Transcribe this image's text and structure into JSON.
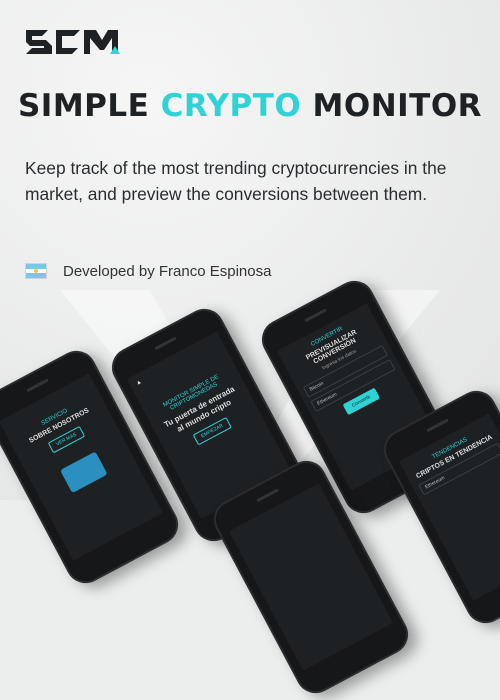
{
  "title": {
    "before": "SIMPLE ",
    "accent": "CRYPTO",
    "after": " MONITOR"
  },
  "description": "Keep track of the most trending cryptocurrencies in the market, and preview the conversions between them.",
  "developer": "Developed by Franco Espinosa",
  "colors": {
    "accent": "#2fd3d6",
    "dark": "#1f2224",
    "background": "#eceded"
  },
  "phones": {
    "about": {
      "tag": "SERVICIO",
      "heading": "SOBRE NOSOTROS",
      "button": "VER MAS"
    },
    "home": {
      "tag": "MONITOR SIMPLE DE CRIPTOMONEDAS",
      "heading": "Tu puerta de entrada al mundo cripto",
      "button": "EMPEZAR"
    },
    "convert": {
      "tag": "CONVERTIR",
      "heading": "PREVISUALIZAR CONVERSIÓN",
      "sub": "Ingresa los datos",
      "coin1": "Bitcoin",
      "coin2": "Ethereum",
      "button": "Convertir"
    },
    "trending": {
      "tag": "TENDENCIAS",
      "heading": "CRIPTOS EN TENDENCIA",
      "coin": "Ethereum"
    }
  }
}
